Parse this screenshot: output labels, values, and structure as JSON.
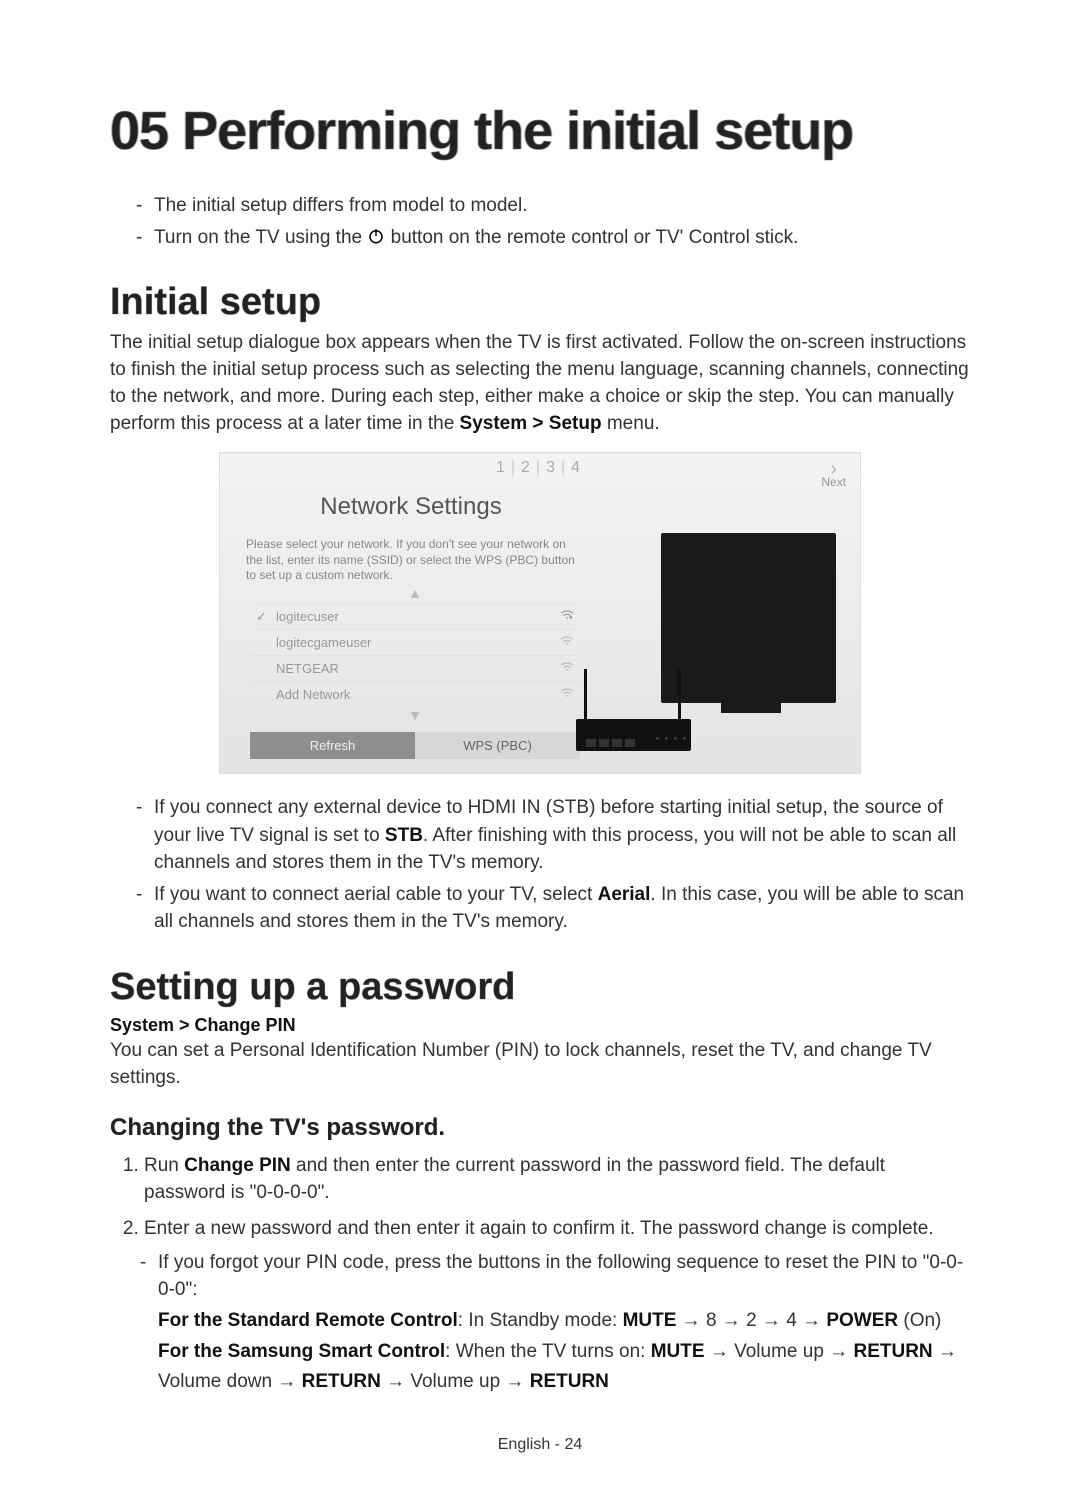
{
  "chapter": {
    "number": "05",
    "title": "Performing the initial setup"
  },
  "intro_notes": [
    "The initial setup differs from model to model.",
    "Turn on the TV using the "
  ],
  "intro_note2_tail": " button on the remote control or TV' Control stick.",
  "section_initial": {
    "title": "Initial setup",
    "body_pre": "The initial setup dialogue box appears when the TV is first activated. Follow the on-screen instructions to finish the initial setup process such as selecting the menu language, scanning channels, connecting to the network, and more. During each step, either make a choice or skip the step. You can manually perform this process at a later time in the ",
    "body_bold": "System > Setup",
    "body_post": " menu."
  },
  "screenshot": {
    "steps": [
      "1",
      "2",
      "3",
      "4"
    ],
    "next_label": "Next",
    "panel_title": "Network Settings",
    "panel_desc": "Please select your network. If you don't see your network on the list, enter its name (SSID) or select the WPS (PBC) button to set up a custom network.",
    "networks": [
      {
        "name": "logitecuser",
        "locked": true,
        "selected": true
      },
      {
        "name": "logitecgameuser",
        "locked": false,
        "selected": false
      },
      {
        "name": "NETGEAR",
        "locked": false,
        "selected": false
      },
      {
        "name": "Add Network",
        "locked": false,
        "selected": false
      }
    ],
    "btn_refresh": "Refresh",
    "btn_wps": "WPS (PBC)"
  },
  "post_notes": {
    "n1_pre": "If you connect any external device to HDMI IN (STB) before starting initial setup, the source of your live TV signal is set to ",
    "n1_bold": "STB",
    "n1_post": ". After finishing with this process, you will not be able to scan all channels and stores them in the TV's memory.",
    "n2_pre": "If you want to connect aerial cable to your TV, select ",
    "n2_bold": "Aerial",
    "n2_post": ". In this case, you will be able to scan all channels and stores them in the TV's memory."
  },
  "section_password": {
    "title": "Setting up a password",
    "breadcrumb": "System > Change PIN",
    "body": "You can set a Personal Identification Number (PIN) to lock channels, reset the TV, and change TV settings."
  },
  "subsection_change": {
    "title": "Changing the TV's password.",
    "step1_pre": "Run ",
    "step1_bold": "Change PIN",
    "step1_post": " and then enter the current password in the password field. The default password is \"0-0-0-0\".",
    "step2": "Enter a new password and then enter it again to confirm it. The password change is complete.",
    "forgot": "If you forgot your PIN code, press the buttons in the following sequence to reset the PIN to \"0-0-0-0\":",
    "remote_std_label": "For the Standard Remote Control",
    "remote_std_seq_pre": ": In Standby mode: ",
    "remote_std_seq": "MUTE → 8 → 2 → 4 → POWER (On)",
    "remote_smart_label": "For the Samsung Smart Control",
    "remote_smart_seq_pre": ": When the TV turns on: ",
    "remote_smart_seq1": "MUTE → Volume up → RETURN →",
    "remote_smart_seq2": "Volume down → RETURN → Volume up → RETURN"
  },
  "footer": {
    "lang": "English",
    "sep": " - ",
    "page": "24"
  }
}
